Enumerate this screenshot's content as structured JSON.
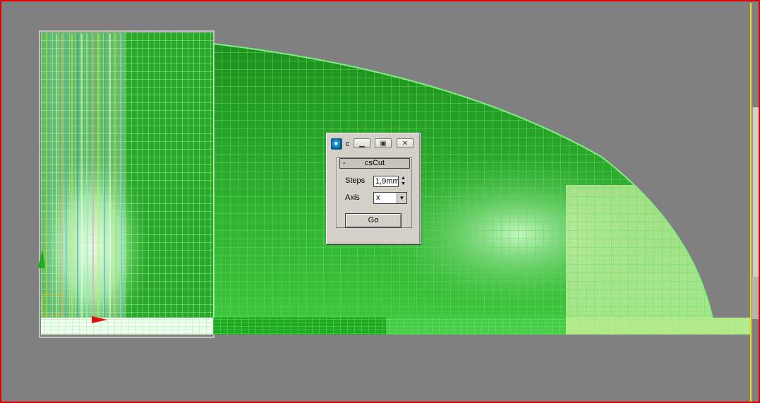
{
  "dialog": {
    "title": "c",
    "rollout_title": "csCut",
    "rollout_toggle": "-",
    "steps_label": "Steps",
    "steps_value": "1,9mm",
    "axis_label": "Axis",
    "axis_value": "x",
    "go_label": "Go"
  },
  "colors": {
    "viewport_bg": "#808080",
    "viewport_border": "#e00000",
    "mesh_green": "#3ccf3c",
    "mesh_light": "#c8f0a0"
  },
  "icons": [
    "app-icon",
    "minimize-icon",
    "maximize-icon",
    "close-icon",
    "spinner-up-icon",
    "spinner-down-icon",
    "dropdown-arrow-icon"
  ]
}
